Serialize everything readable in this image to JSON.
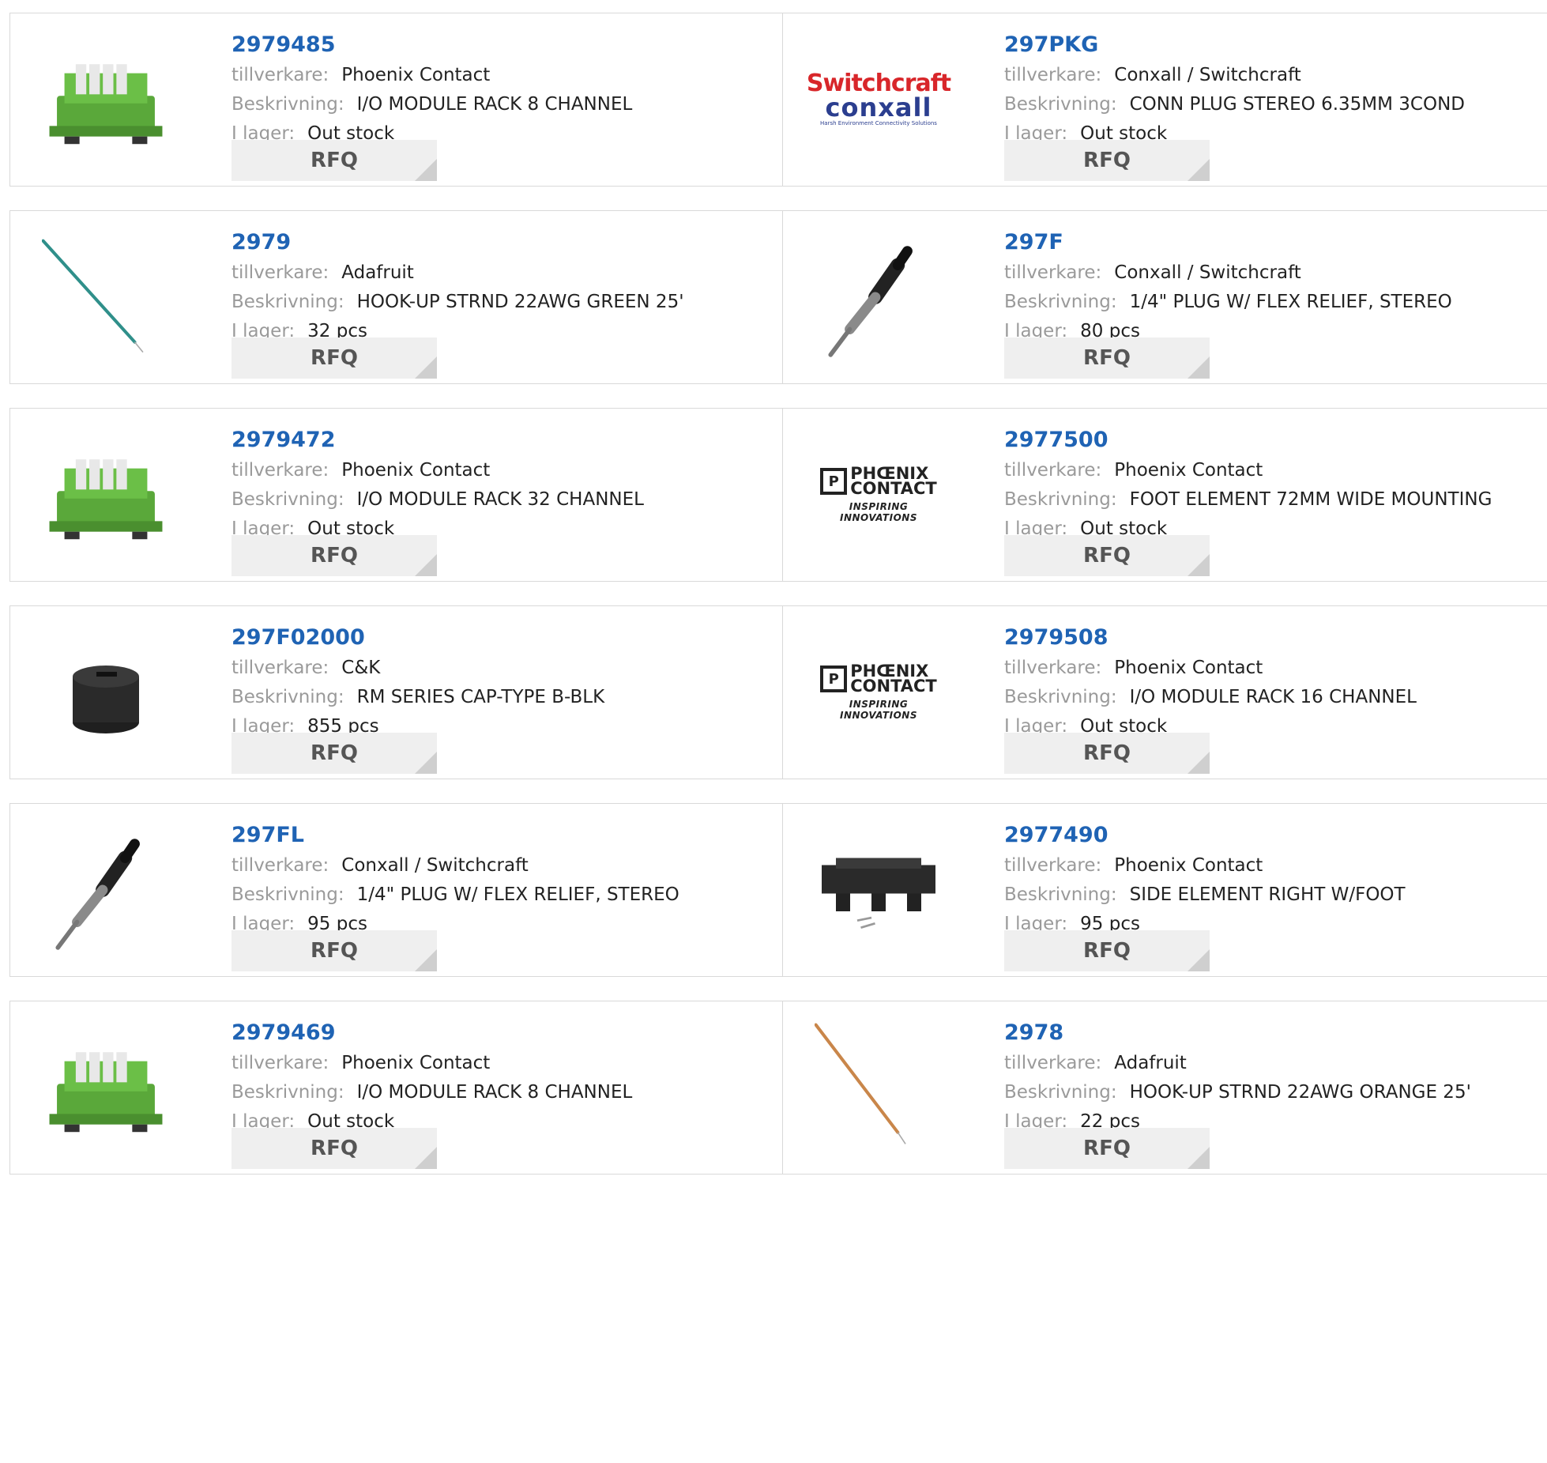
{
  "labels": {
    "manufacturer": "tillverkare:",
    "description": "Beskrivning:",
    "stock": "I lager:",
    "rfq": "RFQ"
  },
  "colors": {
    "part_link": "#1f63b4",
    "label": "#9a9a9a",
    "value": "#222222",
    "rfq_bg": "#efefef",
    "border": "#d9d9d9"
  },
  "logos": {
    "switchcraft": {
      "line1": "Switchcraft",
      "line2": "conxall",
      "tagline": "Harsh Environment Connectivity Solutions"
    },
    "phoenix": {
      "line1": "PHŒNIX",
      "line2": "CONTACT",
      "tagline": "INSPIRING INNOVATIONS"
    }
  },
  "products": [
    {
      "part": "2979485",
      "manufacturer": "Phoenix Contact",
      "description": "I/O MODULE RACK 8 CHANNEL",
      "stock": "Out stock",
      "image": "io-module-rack-icon"
    },
    {
      "part": "297PKG",
      "manufacturer": "Conxall / Switchcraft",
      "description": "CONN PLUG STEREO 6.35MM 3COND",
      "stock": "Out stock",
      "image": "switchcraft-logo"
    },
    {
      "part": "2979",
      "manufacturer": "Adafruit",
      "description": "HOOK-UP STRND 22AWG GREEN 25'",
      "stock": "32 pcs",
      "image": "green-wire-icon"
    },
    {
      "part": "297F",
      "manufacturer": "Conxall / Switchcraft",
      "description": "1/4\" PLUG W/ FLEX RELIEF, STEREO",
      "stock": "80 pcs",
      "image": "audio-plug-icon"
    },
    {
      "part": "2979472",
      "manufacturer": "Phoenix Contact",
      "description": "I/O MODULE RACK 32 CHANNEL",
      "stock": "Out stock",
      "image": "io-module-rack-icon"
    },
    {
      "part": "2977500",
      "manufacturer": "Phoenix Contact",
      "description": "FOOT ELEMENT 72MM WIDE MOUNTING",
      "stock": "Out stock",
      "image": "phoenix-contact-logo"
    },
    {
      "part": "297F02000",
      "manufacturer": "C&K",
      "description": "RM SERIES CAP-TYPE B-BLK",
      "stock": "855 pcs",
      "image": "black-knob-cap-icon"
    },
    {
      "part": "2979508",
      "manufacturer": "Phoenix Contact",
      "description": "I/O MODULE RACK 16 CHANNEL",
      "stock": "Out stock",
      "image": "phoenix-contact-logo"
    },
    {
      "part": "297FL",
      "manufacturer": "Conxall / Switchcraft",
      "description": "1/4\" PLUG W/ FLEX RELIEF, STEREO",
      "stock": "95 pcs",
      "image": "audio-plug-icon"
    },
    {
      "part": "2977490",
      "manufacturer": "Phoenix Contact",
      "description": "SIDE ELEMENT RIGHT W/FOOT",
      "stock": "95 pcs",
      "image": "din-rail-side-element-icon"
    },
    {
      "part": "2979469",
      "manufacturer": "Phoenix Contact",
      "description": "I/O MODULE RACK 8 CHANNEL",
      "stock": "Out stock",
      "image": "io-module-rack-icon"
    },
    {
      "part": "2978",
      "manufacturer": "Adafruit",
      "description": "HOOK-UP STRND 22AWG ORANGE 25'",
      "stock": "22 pcs",
      "image": "orange-wire-icon"
    }
  ]
}
